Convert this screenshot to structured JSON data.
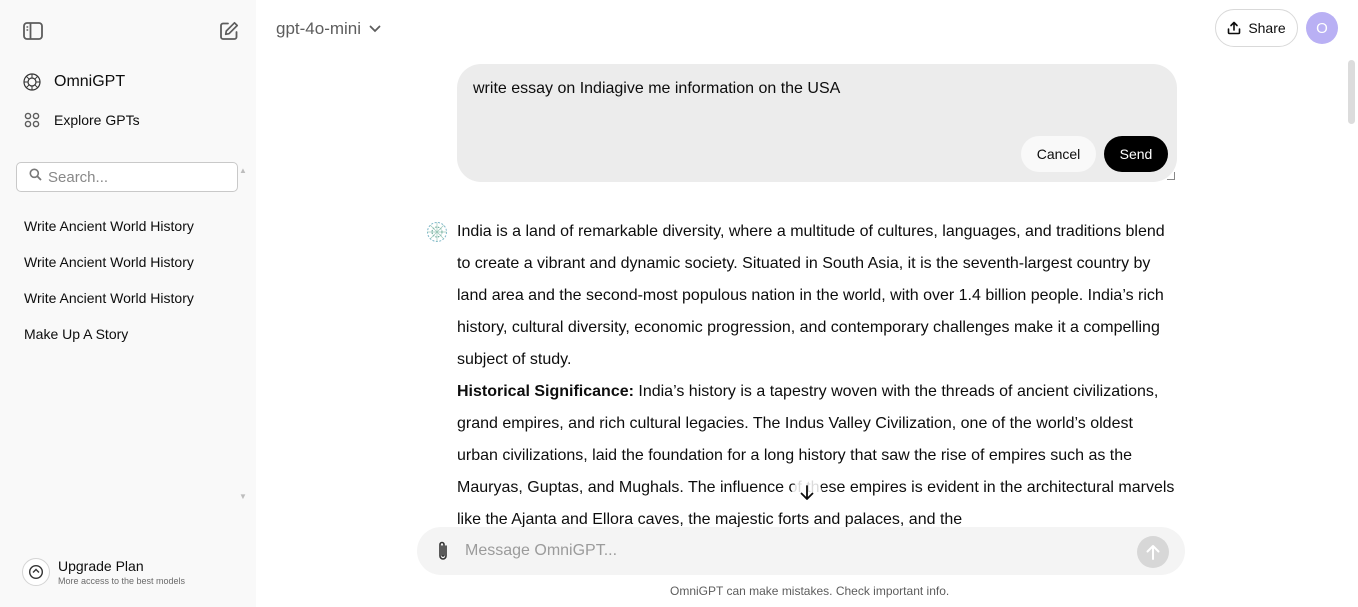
{
  "sidebar": {
    "nav": [
      {
        "label": "OmniGPT",
        "icon": "omnigpt-logo-icon"
      },
      {
        "label": "Explore GPTs",
        "icon": "grid-icon"
      }
    ],
    "search_placeholder": "Search...",
    "history": [
      {
        "title": "Write Ancient World History"
      },
      {
        "title": "Write Ancient World History"
      },
      {
        "title": "Write Ancient World History"
      },
      {
        "title": "Make Up A Story"
      }
    ],
    "upgrade": {
      "title": "Upgrade Plan",
      "subtitle": "More access to the best models"
    }
  },
  "header": {
    "model": "gpt-4o-mini",
    "share_label": "Share",
    "avatar_initial": "O"
  },
  "edit": {
    "text": "write essay on Indiagive me information on the USA",
    "cancel_label": "Cancel",
    "send_label": "Send"
  },
  "response": {
    "para1": "India is a land of remarkable diversity, where a multitude of cultures, languages, and traditions blend to create a vibrant and dynamic society. Situated in South Asia, it is the seventh-largest country by land area and the second-most populous nation in the world, with over 1.4 billion people. India’s rich history, cultural diversity, economic progression, and contemporary challenges make it a compelling subject of study.",
    "heading2": "Historical Significance:",
    "para2": " India’s history is a tapestry woven with the threads of ancient civilizations, grand empires, and rich cultural legacies. The Indus Valley Civilization, one of the world’s oldest urban civilizations, laid the foundation for a long history that saw the rise of empires such as the Mauryas, Guptas, and Mughals. The influence of these empires is evident in the architectural marvels like the Ajanta and Ellora caves, the majestic forts and palaces, and the"
  },
  "composer": {
    "placeholder": "Message OmniGPT..."
  },
  "disclaimer": "OmniGPT can make mistakes. Check important info.",
  "colors": {
    "sidebar_bg": "#f9f9f9",
    "user_bubble": "#ececec",
    "composer_bg": "#f4f4f4",
    "send_button": "#000000",
    "avatar": "#b9b0f4"
  }
}
